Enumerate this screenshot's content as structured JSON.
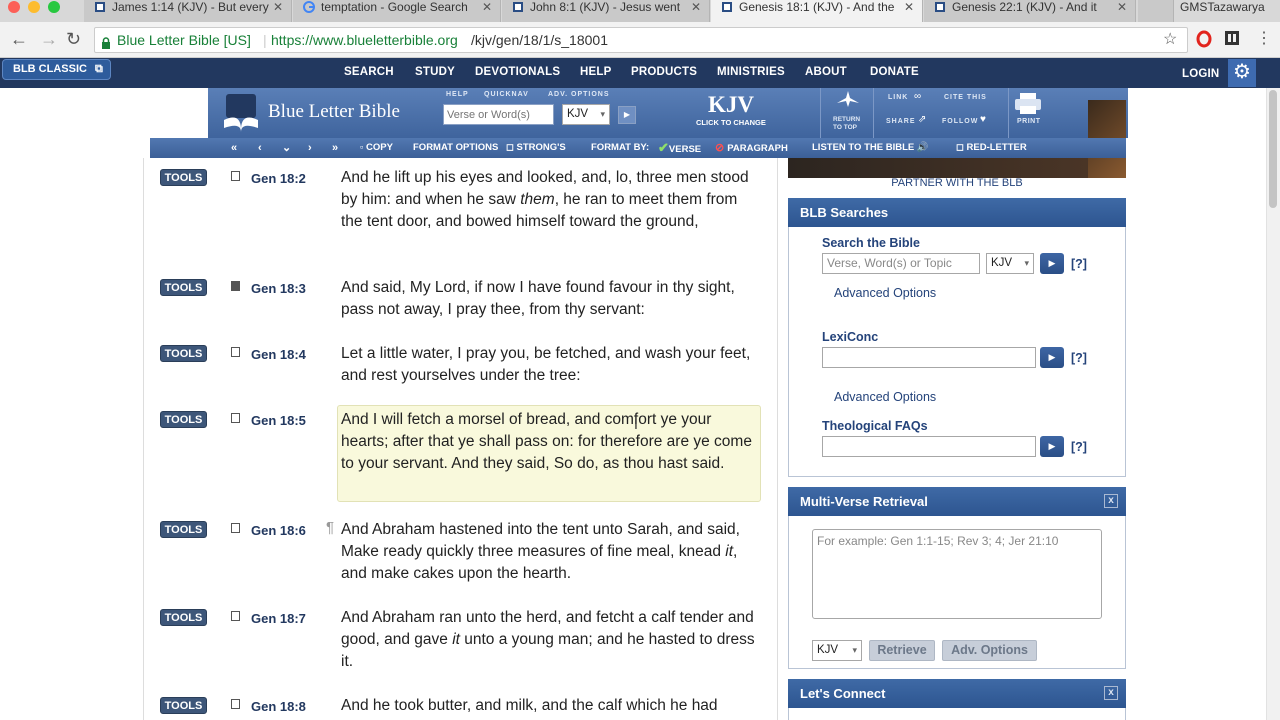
{
  "browser": {
    "tabs": [
      {
        "label": "James 1:14 (KJV) - But every",
        "active": false
      },
      {
        "label": "temptation - Google Search",
        "active": false
      },
      {
        "label": "John 8:1 (KJV) - Jesus went",
        "active": false
      },
      {
        "label": "Genesis 18:1 (KJV) - And the",
        "active": true
      },
      {
        "label": "Genesis 22:1 (KJV) - And it",
        "active": false
      }
    ],
    "profile": "GMSTazawarya",
    "secure_label": "Blue Letter Bible [US]",
    "url_domain": "https://www.blueletterbible.org",
    "url_path": "/kjv/gen/18/1/s_18001"
  },
  "site_nav": {
    "classic": "BLB CLASSIC",
    "items": [
      "SEARCH",
      "STUDY",
      "DEVOTIONALS",
      "HELP",
      "PRODUCTS",
      "MINISTRIES",
      "ABOUT",
      "DONATE"
    ],
    "login": "LOGIN"
  },
  "header": {
    "logo_text": "Blue Letter Bible",
    "help": "HELP",
    "quicknav": "QUICKNAV",
    "adv_options": "ADV. OPTIONS",
    "search_placeholder": "Verse or Word(s)",
    "version": "KJV",
    "version_big": "KJV",
    "click_to_change": "CLICK TO CHANGE",
    "return": "RETURN",
    "to_top": "TO TOP",
    "link": "LINK",
    "share": "SHARE",
    "cite_this": "CITE THIS",
    "follow": "FOLLOW",
    "print": "PRINT"
  },
  "toolbar": {
    "copy": "COPY",
    "format_options": "FORMAT OPTIONS",
    "strongs": "STRONG'S",
    "format_by": "FORMAT BY:",
    "verse": "VERSE",
    "paragraph": "PARAGRAPH",
    "listen": "LISTEN TO THE BIBLE",
    "red_letter": "RED-LETTER"
  },
  "verses": [
    {
      "tools": "TOOLS",
      "ref": "Gen 18:2",
      "text": "And he lift up his eyes and looked, and, lo, three men stood by him: and when he saw them, he ran to meet them from the tent door, and bowed himself toward the ground,"
    },
    {
      "tools": "TOOLS",
      "ref": "Gen 18:3",
      "text": "And said, My Lord, if now I have found favour in thy sight, pass not away, I pray thee, from thy servant:"
    },
    {
      "tools": "TOOLS",
      "ref": "Gen 18:4",
      "text": "Let a little water, I pray you, be fetched, and wash your feet, and rest yourselves under the tree:"
    },
    {
      "tools": "TOOLS",
      "ref": "Gen 18:5",
      "text": "And I will fetch a morsel of bread, and comfort ye your hearts; after that ye shall pass on: for therefore are ye come to your servant. And they said, So do, as thou hast said."
    },
    {
      "tools": "TOOLS",
      "ref": "Gen 18:6",
      "text": "And Abraham hastened into the tent unto Sarah, and said, Make ready quickly three measures of fine meal, knead it, and make cakes upon the hearth."
    },
    {
      "tools": "TOOLS",
      "ref": "Gen 18:7",
      "text": "And Abraham ran unto the herd, and fetcht a calf tender and good, and gave it unto a young man; and he hasted to dress it."
    },
    {
      "tools": "TOOLS",
      "ref": "Gen 18:8",
      "text": "And he took butter, and milk, and the calf which he had"
    }
  ],
  "sidebar": {
    "partner": "PARTNER WITH THE BLB",
    "searches_title": "BLB Searches",
    "search_bible_label": "Search the Bible",
    "search_bible_placeholder": "Verse, Word(s) or Topic",
    "search_version": "KJV",
    "help": "[?]",
    "advanced_options": "Advanced Options",
    "lexiconc_label": "LexiConc",
    "theo_label": "Theological FAQs",
    "multiverse_title": "Multi-Verse Retrieval",
    "multiverse_placeholder": "For example: Gen 1:1-15; Rev 3; 4; Jer 21:10",
    "mv_version": "KJV",
    "retrieve": "Retrieve",
    "adv_options_btn": "Adv. Options",
    "connect_title": "Let's Connect",
    "close": "x"
  }
}
